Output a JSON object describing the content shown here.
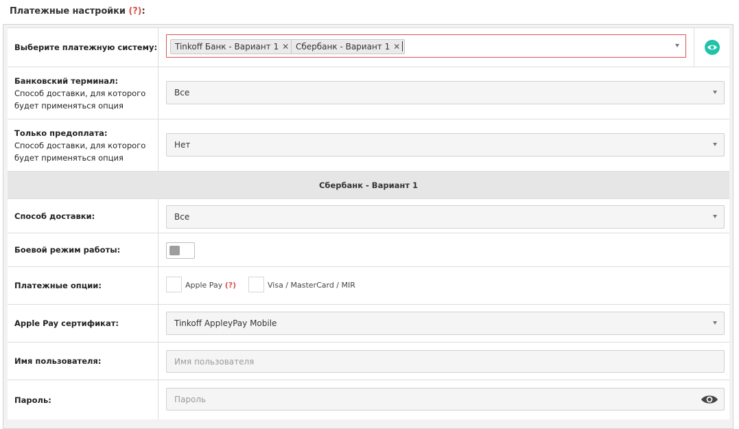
{
  "header": {
    "title": "Платежные настройки",
    "help": "(?)",
    "colon": ":"
  },
  "colors": {
    "accent_teal": "#20c3a8",
    "error_red": "#d9534f"
  },
  "payment_system": {
    "label": "Выберите платежную систему:",
    "selected": [
      "Tinkoff Банк - Вариант 1",
      "Сбербанк - Вариант 1"
    ],
    "remove_icon": "close-icon",
    "toggle_icon": "eye-icon"
  },
  "bank_terminal": {
    "label": "Банковский терминал:",
    "sub": "Способ доставки, для которого будет применяться опция",
    "value": "Все"
  },
  "prepay_only": {
    "label": "Только предоплата:",
    "sub": "Способ доставки, для которого будет применяться опция",
    "value": "Нет"
  },
  "section": {
    "title": "Сбербанк - Вариант 1"
  },
  "delivery": {
    "label": "Способ доставки:",
    "value": "Все"
  },
  "live_mode": {
    "label": "Боевой режим работы:",
    "enabled": false
  },
  "payment_options": {
    "label": "Платежные опции:",
    "options": [
      {
        "label": "Apple Pay",
        "help": "(?)",
        "checked": false
      },
      {
        "label": "Visa / MasterCard / MIR",
        "checked": false
      }
    ]
  },
  "apple_cert": {
    "label": "Apple Pay сертификат:",
    "value": "Tinkoff AppleyPay Mobile"
  },
  "username": {
    "label": "Имя пользователя:",
    "placeholder": "Имя пользователя"
  },
  "password": {
    "label": "Пароль:",
    "placeholder": "Пароль",
    "icon": "eye-icon"
  }
}
